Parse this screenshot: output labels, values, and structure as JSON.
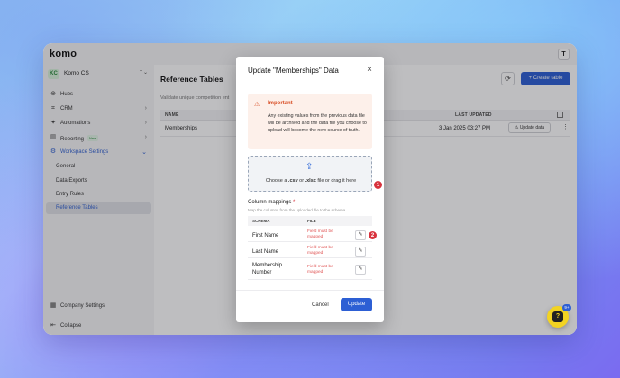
{
  "app": {
    "logo": "komo",
    "user_initial": "T"
  },
  "sidebar": {
    "org": {
      "badge": "KC",
      "name": "Komo CS",
      "chevron": "⌃⌄"
    },
    "items": [
      {
        "label": "Hubs",
        "icon": "globe-icon"
      },
      {
        "label": "CRM",
        "icon": "crm-icon",
        "chevron": "›"
      },
      {
        "label": "Automations",
        "icon": "automations-icon",
        "chevron": "›"
      },
      {
        "label": "Reporting",
        "icon": "reporting-icon",
        "badge": "New",
        "chevron": "›"
      },
      {
        "label": "Workspace Settings",
        "icon": "settings-icon",
        "chevron": "⌄"
      }
    ],
    "sub_items": [
      {
        "label": "General"
      },
      {
        "label": "Data Exports"
      },
      {
        "label": "Entry Rules"
      },
      {
        "label": "Reference Tables"
      }
    ],
    "footer": {
      "company_settings": "Company Settings",
      "collapse": "Collapse"
    }
  },
  "main": {
    "title": "Reference Tables",
    "subtitle": "Validate unique competition ent",
    "refresh_icon": "⟳",
    "create_button": "+  Create table",
    "table": {
      "headers": {
        "name": "NAME",
        "last_updated": "LAST UPDATED"
      },
      "rows": [
        {
          "name": "Memberships",
          "last_updated": "3 Jan 2025 03:27 PM",
          "action": "Update data"
        }
      ]
    }
  },
  "modal": {
    "title": "Update \"Memberships\" Data",
    "close": "×",
    "alert": {
      "title": "Important",
      "body": "Any existing values from the previous data file will be archived and the data file you choose to upload will become the new source of truth."
    },
    "dropzone": {
      "prefix": "Choose a ",
      "csv": ".csv",
      "or": " or ",
      "xlsx": ".xlsx",
      "suffix": " file or drag it here"
    },
    "column_mappings": {
      "label": "Column mappings",
      "required": "*",
      "hint": "Map the columns from the uploaded file to the schema.",
      "headers": {
        "schema": "SCHEMA",
        "file": "FILE"
      },
      "rows": [
        {
          "schema": "First Name",
          "file_status": "Field must be mapped"
        },
        {
          "schema": "Last Name",
          "file_status": "Field must be mapped"
        },
        {
          "schema": "Membership Number",
          "file_status": "Field must be mapped"
        }
      ]
    },
    "cancel": "Cancel",
    "update": "Update"
  },
  "markers": [
    "1",
    "2"
  ],
  "help": {
    "label": "?",
    "badge": "9+"
  },
  "colors": {
    "accent": "#2d5fd4",
    "warning": "#d9522a",
    "error": "#e05656",
    "marker": "#d8323d",
    "help": "#f2d322"
  }
}
